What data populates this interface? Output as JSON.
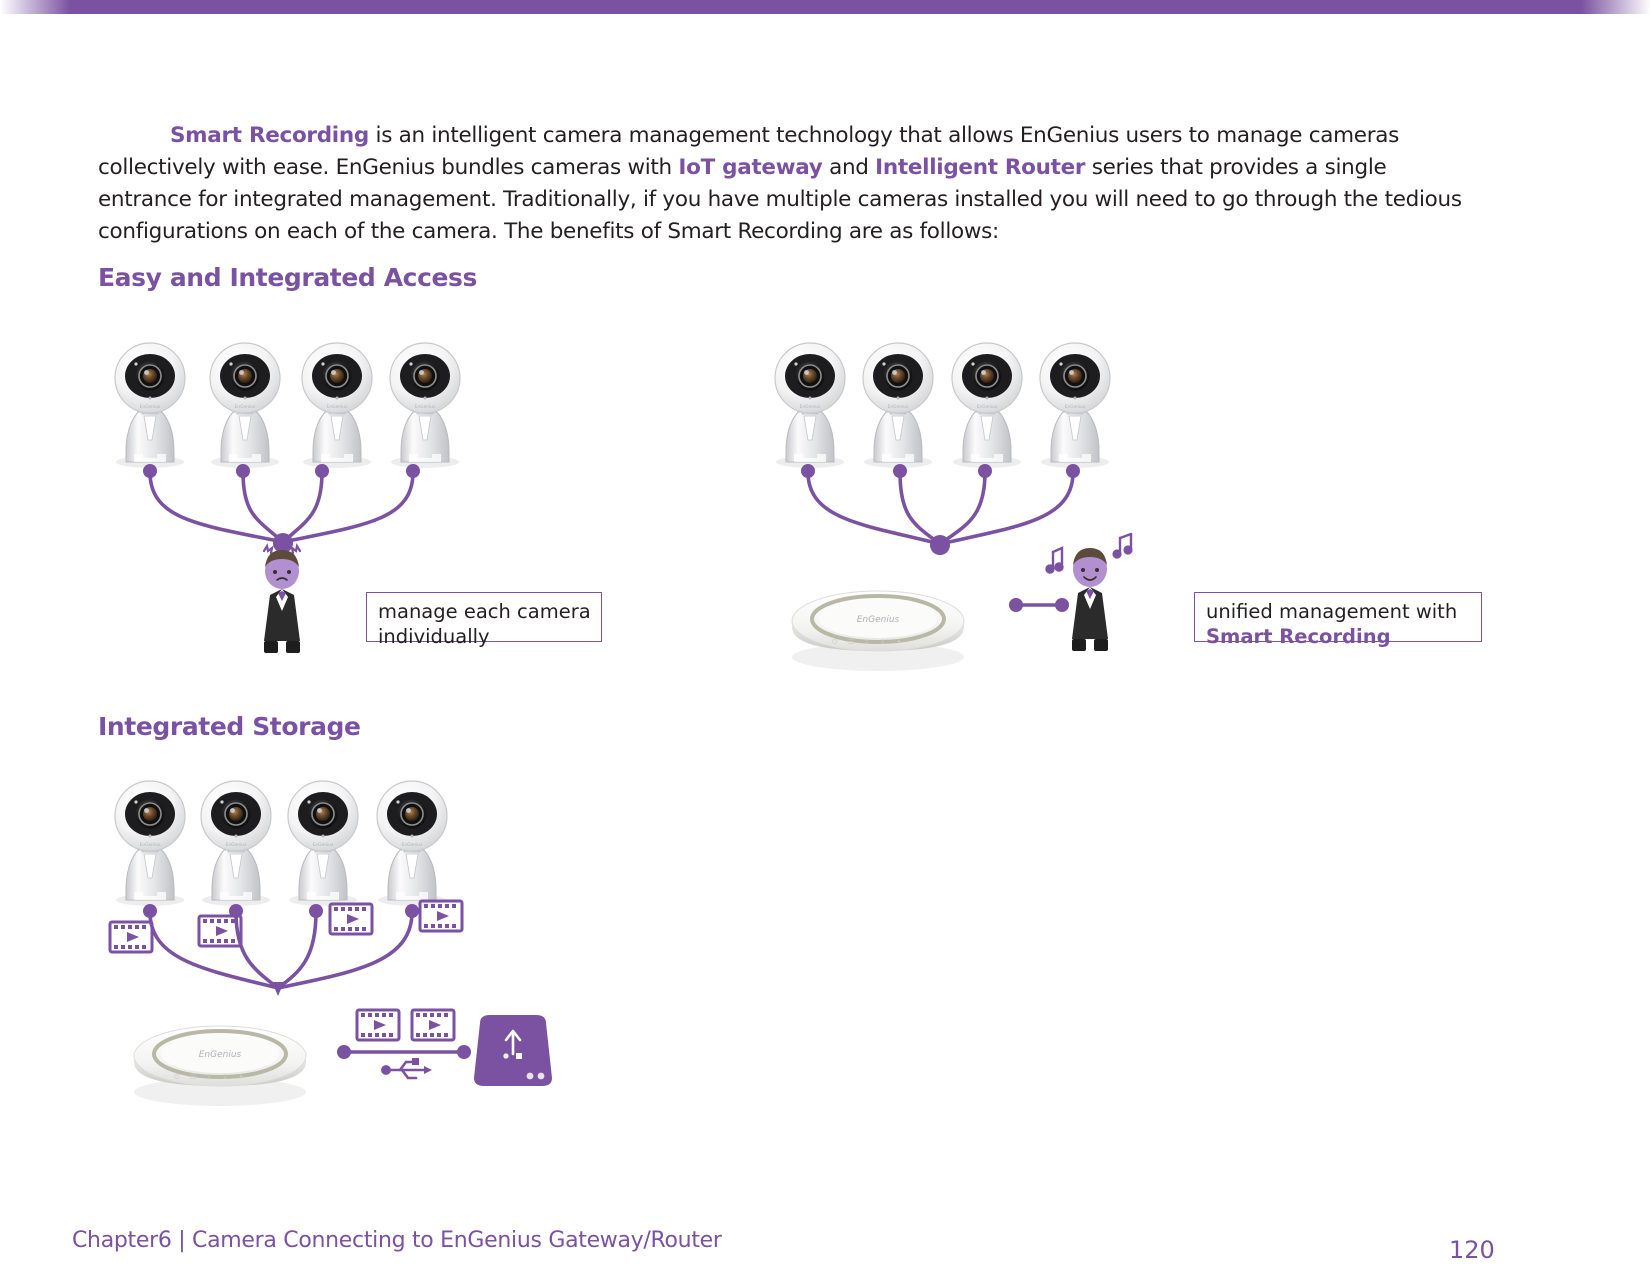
{
  "page": {
    "title": "Smart Recording",
    "accent_color": "#7a52a1",
    "text_color": "#231f20"
  },
  "intro": {
    "lead": "Smart Recording",
    "t1": " is an intelligent camera management technology that allows EnGenius users to manage cameras collectively with ease. EnGenius bundles cameras with ",
    "hl2": "IoT gateway",
    "t2": " and ",
    "hl3": "Intelligent Router",
    "t3": " series that provides a single entrance for integrated management. Traditionally, if you have multiple cameras installed you will need to go through the tedious configurations on each of the camera. The benefits of Smart Recording are as follows:"
  },
  "sections": {
    "access": "Easy and Integrated Access",
    "storage": "Integrated Storage"
  },
  "callouts": {
    "left": {
      "line1": "manage each camera",
      "line2": "individually"
    },
    "right": {
      "line1": "unified management with",
      "line2": "Smart Recording"
    }
  },
  "diagram_access": {
    "left_group": {
      "camera_count": 4,
      "person_label": "confused-admin",
      "device": "none"
    },
    "right_group": {
      "camera_count": 4,
      "device": "engenius-gateway",
      "device_brand": "EnGenius",
      "person_label": "happy-admin"
    }
  },
  "diagram_storage": {
    "camera_count": 4,
    "video_clip_count": 4,
    "gateway_brand": "EnGenius",
    "stored_clip_count": 2,
    "storage_device": "usb-hard-drive",
    "connector": "usb"
  },
  "footer": {
    "chapter": "Chapter6  |  Camera Connecting to EnGenius Gateway/Router",
    "page_number": "120"
  }
}
